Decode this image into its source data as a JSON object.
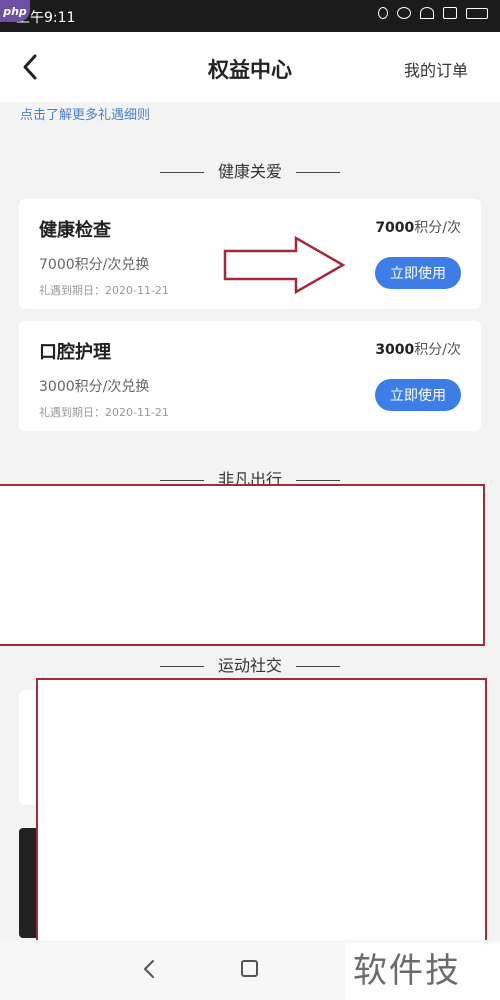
{
  "status_bar": {
    "time": "上午9:11"
  },
  "watermark_logo": "php",
  "header": {
    "title": "权益中心",
    "my_orders": "我的订单"
  },
  "rules_link": "点击了解更多礼遇细则",
  "sections": {
    "health": "健康关爱",
    "travel": "非凡出行",
    "sports": "运动社交"
  },
  "cards": [
    {
      "name": "健康检查",
      "points_num": "7000",
      "points_unit": "积分/次",
      "sub": "7000积分/次兑换",
      "expire": "礼遇到期日：2020-11-21",
      "button": "立即使用"
    },
    {
      "name": "口腔护理",
      "points_num": "3000",
      "points_unit": "积分/次",
      "sub": "3000积分/次兑换",
      "expire": "礼遇到期日：2020-11-21",
      "button": "立即使用"
    }
  ],
  "footer_watermark": "软件技巧",
  "colors": {
    "accent": "#3d7ee6",
    "annotation": "#a22a3b"
  }
}
